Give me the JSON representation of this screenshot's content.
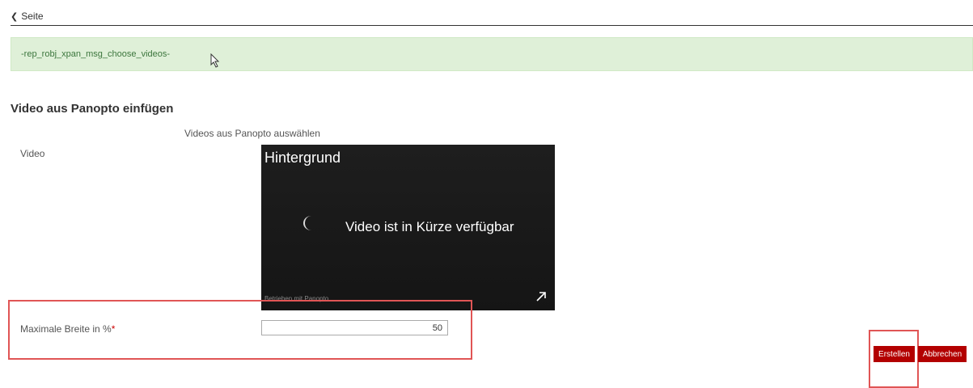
{
  "nav": {
    "back_label": "Seite"
  },
  "message": {
    "text": "-rep_robj_xpan_msg_choose_videos-"
  },
  "form": {
    "title": "Video aus Panopto einfügen",
    "info": "Videos aus Panopto auswählen",
    "video_label": "Video",
    "width_label": "Maximale Breite in %",
    "required_marker": "*",
    "width_value": "50"
  },
  "video": {
    "title": "Hintergrund",
    "status": "Video ist in Kürze verfügbar",
    "powered_by": "Betrieben mit Panopto"
  },
  "buttons": {
    "create": "Erstellen",
    "cancel": "Abbrechen"
  },
  "colors": {
    "accent": "#b30000",
    "success_bg": "#dff0d8",
    "highlight": "#e05555"
  }
}
